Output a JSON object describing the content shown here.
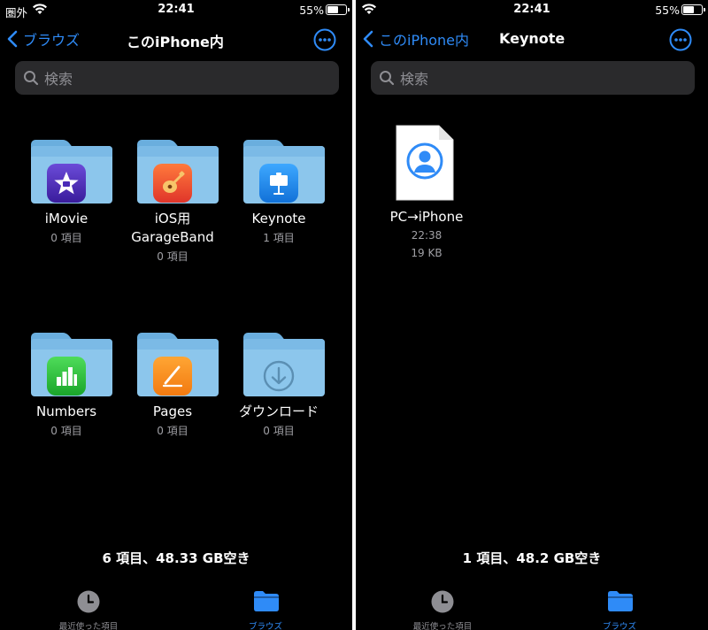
{
  "colors": {
    "accent": "#2f8bf7",
    "background": "#000000",
    "search_bg": "#2a2a2c",
    "folder": "#8cc6ec",
    "secondary_text": "#a0a0a5"
  },
  "status": {
    "carrier": "圏外",
    "time": "22:41",
    "battery": "55%"
  },
  "left": {
    "back_label": "ブラウズ",
    "title": "このiPhone内",
    "search_placeholder": "検索",
    "items": [
      {
        "name": "iMovie",
        "count": "0 項目",
        "icon": "imove-icon"
      },
      {
        "name": "iOS用\nGarageBand",
        "count": "0 項目",
        "icon": "garageband-icon"
      },
      {
        "name": "Keynote",
        "count": "1 項目",
        "icon": "keynote-icon"
      },
      {
        "name": "Numbers",
        "count": "0 項目",
        "icon": "numbers-icon"
      },
      {
        "name": "Pages",
        "count": "0 項目",
        "icon": "pages-icon"
      },
      {
        "name": "ダウンロード",
        "count": "0 項目",
        "icon": "download-icon"
      }
    ],
    "summary": "6 項目、48.33 GB空き"
  },
  "right": {
    "back_label": "このiPhone内",
    "title": "Keynote",
    "search_placeholder": "検索",
    "file": {
      "name": "PC→iPhone",
      "time": "22:38",
      "size": "19 KB"
    },
    "summary": "1 項目、48.2 GB空き"
  },
  "tabbar": {
    "recents": "最近使った項目",
    "browse": "ブラウズ"
  }
}
